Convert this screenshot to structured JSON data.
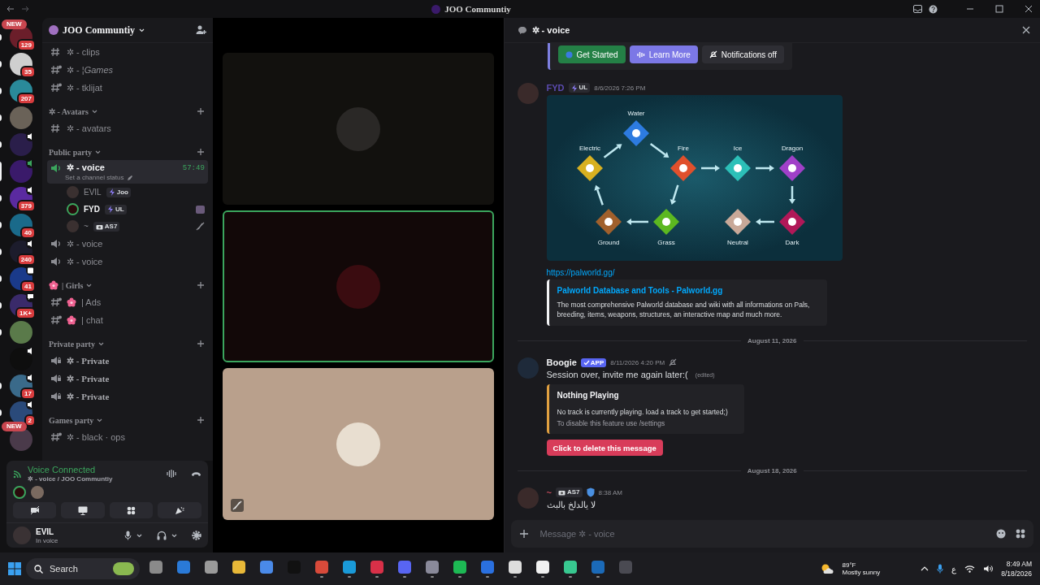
{
  "title_bar": {
    "title": "JOO Communtiy"
  },
  "servers": [
    {
      "label": "NEW",
      "badge": "129",
      "color": "#6b1e2a",
      "unread": true,
      "selected": false
    },
    {
      "badge": "35",
      "color": "#cfcfcf",
      "unread": true,
      "selected": false
    },
    {
      "badge": "207",
      "color": "#2a8a9a",
      "unread": true,
      "selected": false
    },
    {
      "color": "#6a6258",
      "unread": true,
      "selected": false
    },
    {
      "color": "#2a1e4a",
      "unread": true,
      "selected": false,
      "in_voice": true
    },
    {
      "color": "#3a1a6a",
      "unread": false,
      "selected": true,
      "in_voice": true
    },
    {
      "badge": "379",
      "color": "#5a2aa0",
      "unread": true,
      "selected": false,
      "in_voice": true
    },
    {
      "badge": "40",
      "color": "#1a6a8a",
      "unread": true,
      "selected": false
    },
    {
      "badge": "240",
      "color": "#1c1c2c",
      "unread": true,
      "selected": false,
      "in_voice": true
    },
    {
      "badge": "41",
      "color": "#1a3a8a",
      "unread": true,
      "selected": false,
      "has_event": true
    },
    {
      "badge": "1K+",
      "color": "#3a2a6a",
      "unread": true,
      "selected": false,
      "has_stage": true
    },
    {
      "color": "#5a7a4a",
      "unread": true,
      "selected": false
    },
    {
      "color": "#0e0e0e",
      "unread": false,
      "selected": false,
      "in_voice": true
    },
    {
      "badge": "17",
      "color": "#3a6a8a",
      "unread": true,
      "selected": false,
      "in_voice": true
    },
    {
      "badge": "2",
      "color": "#2a4a7a",
      "unread": true,
      "selected": false,
      "in_voice": true
    },
    {
      "label": "NEW",
      "color": "#4a3a4a",
      "unread": false,
      "selected": false
    }
  ],
  "sidebar": {
    "server_name": "JOO Communtiy",
    "channels": [
      {
        "kind": "text",
        "name": "✲ - clips",
        "threads": false,
        "selected": false
      },
      {
        "kind": "text",
        "name": "✲ - ¦*Games*",
        "threads": true,
        "selected": false
      },
      {
        "kind": "text",
        "name": "✲ - tklijat",
        "threads": true,
        "selected": false
      },
      {
        "kind": "category",
        "name": "✲ - Avatars"
      },
      {
        "kind": "text",
        "name": "✲ - avatars",
        "threads": false,
        "selected": false
      },
      {
        "kind": "category",
        "name": "Public party"
      },
      {
        "kind": "voice",
        "name": "✲ - voice",
        "status": "Set a channel status",
        "time": "57:49",
        "locked": false,
        "selected": true
      },
      {
        "kind": "member",
        "name": "EVIL",
        "tag": {
          "kind": "bolt",
          "text": "Joo"
        },
        "speaking": false,
        "video": false,
        "muted": false
      },
      {
        "kind": "member",
        "name": "FYD",
        "tag": {
          "kind": "bolt",
          "text": "UL"
        },
        "speaking": true,
        "video": true,
        "muted": false
      },
      {
        "kind": "member",
        "name": "~",
        "tag": {
          "kind": "camera",
          "text": "AS7"
        },
        "speaking": false,
        "video": false,
        "muted": true
      },
      {
        "kind": "voice",
        "name": "✲ - voice",
        "locked": false,
        "selected": false
      },
      {
        "kind": "voice",
        "name": "✲ - voice",
        "locked": false,
        "selected": false
      },
      {
        "kind": "category",
        "name": "| Girls",
        "flower": true
      },
      {
        "kind": "text",
        "name": "| Ads",
        "flower": true,
        "threads": true,
        "selected": false
      },
      {
        "kind": "text",
        "name": "| chat",
        "flower": true,
        "threads": true,
        "selected": false
      },
      {
        "kind": "category",
        "name": "Private party"
      },
      {
        "kind": "voice",
        "name": "✲ - Private",
        "locked": true,
        "selected": false
      },
      {
        "kind": "voice",
        "name": "✲ - Private",
        "locked": true,
        "selected": false
      },
      {
        "kind": "voice",
        "name": "✲ - Private",
        "locked": true,
        "selected": false
      },
      {
        "kind": "category",
        "name": "Games party"
      },
      {
        "kind": "text",
        "name": "✲ - black · ops",
        "threads": true,
        "selected": false
      }
    ]
  },
  "voice_panel": {
    "status": "Voice Connected",
    "location": "✲ - voice / JOO Communtiy"
  },
  "user_panel": {
    "name": "EVIL",
    "status": "In voice"
  },
  "tiles": [
    {
      "color": "#12110e",
      "speaking": false,
      "muted": false
    },
    {
      "color": "#120808",
      "speaking": true,
      "muted": false
    },
    {
      "color": "#b9a08c",
      "speaking": false,
      "muted": true
    }
  ],
  "chat": {
    "channel": "✲ - voice",
    "messages": [
      {
        "kind": "buttons",
        "buttons": [
          "Get Started",
          "Learn More",
          "Notifications off"
        ]
      },
      {
        "kind": "message",
        "author": "FYD",
        "color": "#5b4bb0",
        "tag": {
          "kind": "bolt",
          "text": "UL"
        },
        "time": "8/6/2026 7:26 PM",
        "diagram": {
          "nodes": [
            {
              "label": "Water",
              "color": "#2d7be0"
            },
            {
              "label": "Electric",
              "color": "#d8b020"
            },
            {
              "label": "Fire",
              "color": "#e0502c"
            },
            {
              "label": "Ice",
              "color": "#2cc0b8"
            },
            {
              "label": "Dragon",
              "color": "#a040c8"
            },
            {
              "label": "Ground",
              "color": "#a0602c"
            },
            {
              "label": "Grass",
              "color": "#5cb820"
            },
            {
              "label": "Neutral",
              "color": "#c8a898"
            },
            {
              "label": "Dark",
              "color": "#b01858"
            }
          ]
        },
        "link": "https://palworld.gg/",
        "embed": {
          "title": "Palworld Database and Tools - Palworld.gg",
          "description": "The most comprehensive Palworld database and wiki with all informations on Pals, breeding, items, weapons, structures, an interactive map and much more."
        }
      },
      {
        "kind": "divider",
        "date": "August 11, 2026"
      },
      {
        "kind": "message",
        "author": "Boogie",
        "color": "#f2f3f5",
        "badge": "APP",
        "time": "8/11/2026 4:20 PM",
        "silent": true,
        "text": "Session over, invite me again later:(",
        "edited": "(edited)",
        "card": {
          "title": "Nothing Playing",
          "description": "No track is currently playing. load a track to get started;)",
          "footer": "To disable this feature use /settings"
        },
        "action": "Click to delete this message"
      },
      {
        "kind": "divider",
        "date": "August 18, 2026"
      },
      {
        "kind": "message",
        "author": "~",
        "color": "#c04a5a",
        "tag": {
          "kind": "camera",
          "text": "AS7"
        },
        "shield": true,
        "time": "8:38 AM",
        "text": "لا يالدلخ بالبث"
      }
    ],
    "input": {
      "placeholder": "Message ✲ - voice"
    }
  },
  "taskbar": {
    "search": {
      "placeholder": "Search"
    },
    "apps": [
      {
        "color": "#8a8a8a",
        "open": false
      },
      {
        "color": "#2a7ad8",
        "open": false
      },
      {
        "color": "#9a9a9a",
        "open": false
      },
      {
        "color": "#e8b838",
        "open": false
      },
      {
        "color": "#4a8ae8",
        "open": false
      },
      {
        "color": "#111111",
        "open": false
      },
      {
        "color": "#d84a3a",
        "open": true
      },
      {
        "color": "#1a9ad8",
        "open": true
      },
      {
        "color": "#d83048",
        "open": true
      },
      {
        "color": "#5865f2",
        "open": true
      },
      {
        "color": "#8a8a9a",
        "open": true
      },
      {
        "color": "#1db954",
        "open": true
      },
      {
        "color": "#2a70e0",
        "open": true
      },
      {
        "color": "#dddddd",
        "open": true
      },
      {
        "color": "#f0f0f0",
        "open": true
      },
      {
        "color": "#38c890",
        "open": true
      },
      {
        "color": "#1b6ab8",
        "open": true
      },
      {
        "color": "#4a4a52",
        "open": false
      }
    ],
    "weather": {
      "temp": "89°F",
      "condition": "Mostly sunny"
    },
    "language": "ع",
    "time": "8:49 AM",
    "date": "8/18/2026"
  }
}
